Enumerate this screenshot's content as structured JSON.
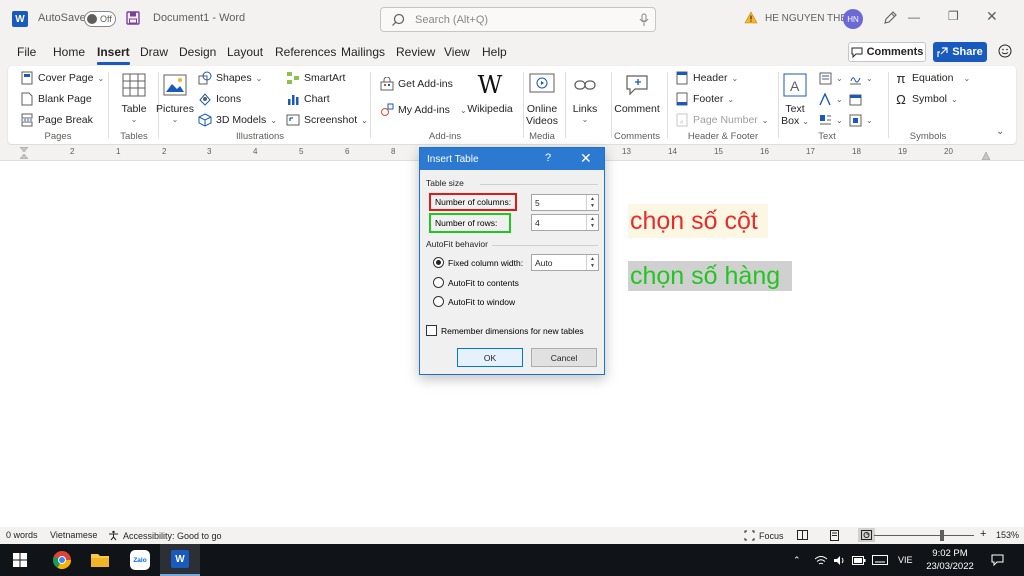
{
  "titlebar": {
    "autosave_label": "AutoSave",
    "autosave_state": "Off",
    "document_title": "Document1",
    "separator": "-",
    "app_name": "Word",
    "search_placeholder": "Search (Alt+Q)",
    "user_name": "HE NGUYEN THE",
    "user_initials": "HN"
  },
  "menu": {
    "tabs": [
      "File",
      "Home",
      "Insert",
      "Draw",
      "Design",
      "Layout",
      "References",
      "Mailings",
      "Review",
      "View",
      "Help"
    ],
    "active_tab": "Insert",
    "comments_label": "Comments",
    "share_label": "Share"
  },
  "ribbon": {
    "pages": {
      "cover_page": "Cover Page",
      "blank_page": "Blank Page",
      "page_break": "Page Break",
      "label": "Pages"
    },
    "tables": {
      "table": "Table",
      "label": "Tables"
    },
    "illustrations": {
      "pictures": "Pictures",
      "shapes": "Shapes",
      "icons": "Icons",
      "models": "3D Models",
      "smartart": "SmartArt",
      "chart": "Chart",
      "screenshot": "Screenshot",
      "label": "Illustrations"
    },
    "addins": {
      "get": "Get Add-ins",
      "my": "My Add-ins",
      "wikipedia": "Wikipedia",
      "label": "Add-ins"
    },
    "media": {
      "online": "Online",
      "videos": "Videos",
      "label": "Media"
    },
    "links": {
      "links": "Links"
    },
    "comments": {
      "comment": "Comment",
      "label": "Comments"
    },
    "header_footer": {
      "header": "Header",
      "footer": "Footer",
      "page_number": "Page Number",
      "label": "Header & Footer"
    },
    "text": {
      "text": "Text",
      "box": "Box",
      "label": "Text"
    },
    "symbols": {
      "equation": "Equation",
      "symbol": "Symbol",
      "label": "Symbols"
    }
  },
  "ruler": {
    "numbers": [
      "2",
      "1",
      "1",
      "2",
      "3",
      "4",
      "5",
      "6",
      "7",
      "8",
      "13",
      "14",
      "15",
      "16",
      "17",
      "18",
      "19",
      "20"
    ]
  },
  "dialog": {
    "title": "Insert Table",
    "help": "?",
    "table_size_label": "Table size",
    "columns_label": "Number of columns:",
    "columns_value": "5",
    "rows_label": "Number of rows:",
    "rows_value": "4",
    "autofit_label": "AutoFit behavior",
    "fixed_width_label": "Fixed column width:",
    "fixed_width_value": "Auto",
    "autofit_contents_label": "AutoFit to contents",
    "autofit_window_label": "AutoFit to window",
    "remember_label": "Remember dimensions for new tables",
    "ok_label": "OK",
    "cancel_label": "Cancel"
  },
  "annotations": {
    "columns": "chọn số cột",
    "rows": "chọn số hàng",
    "columns_color": "#e82c2c",
    "rows_color": "#23c523"
  },
  "statusbar": {
    "words": "0 words",
    "language": "Vietnamese",
    "accessibility": "Accessibility: Good to go",
    "focus": "Focus",
    "zoom_minus": "-",
    "zoom_plus": "+",
    "zoom": "153%"
  },
  "taskbar": {
    "zalo": "Zalo",
    "language": "VIE",
    "time": "9:02 PM",
    "date": "23/03/2022"
  }
}
